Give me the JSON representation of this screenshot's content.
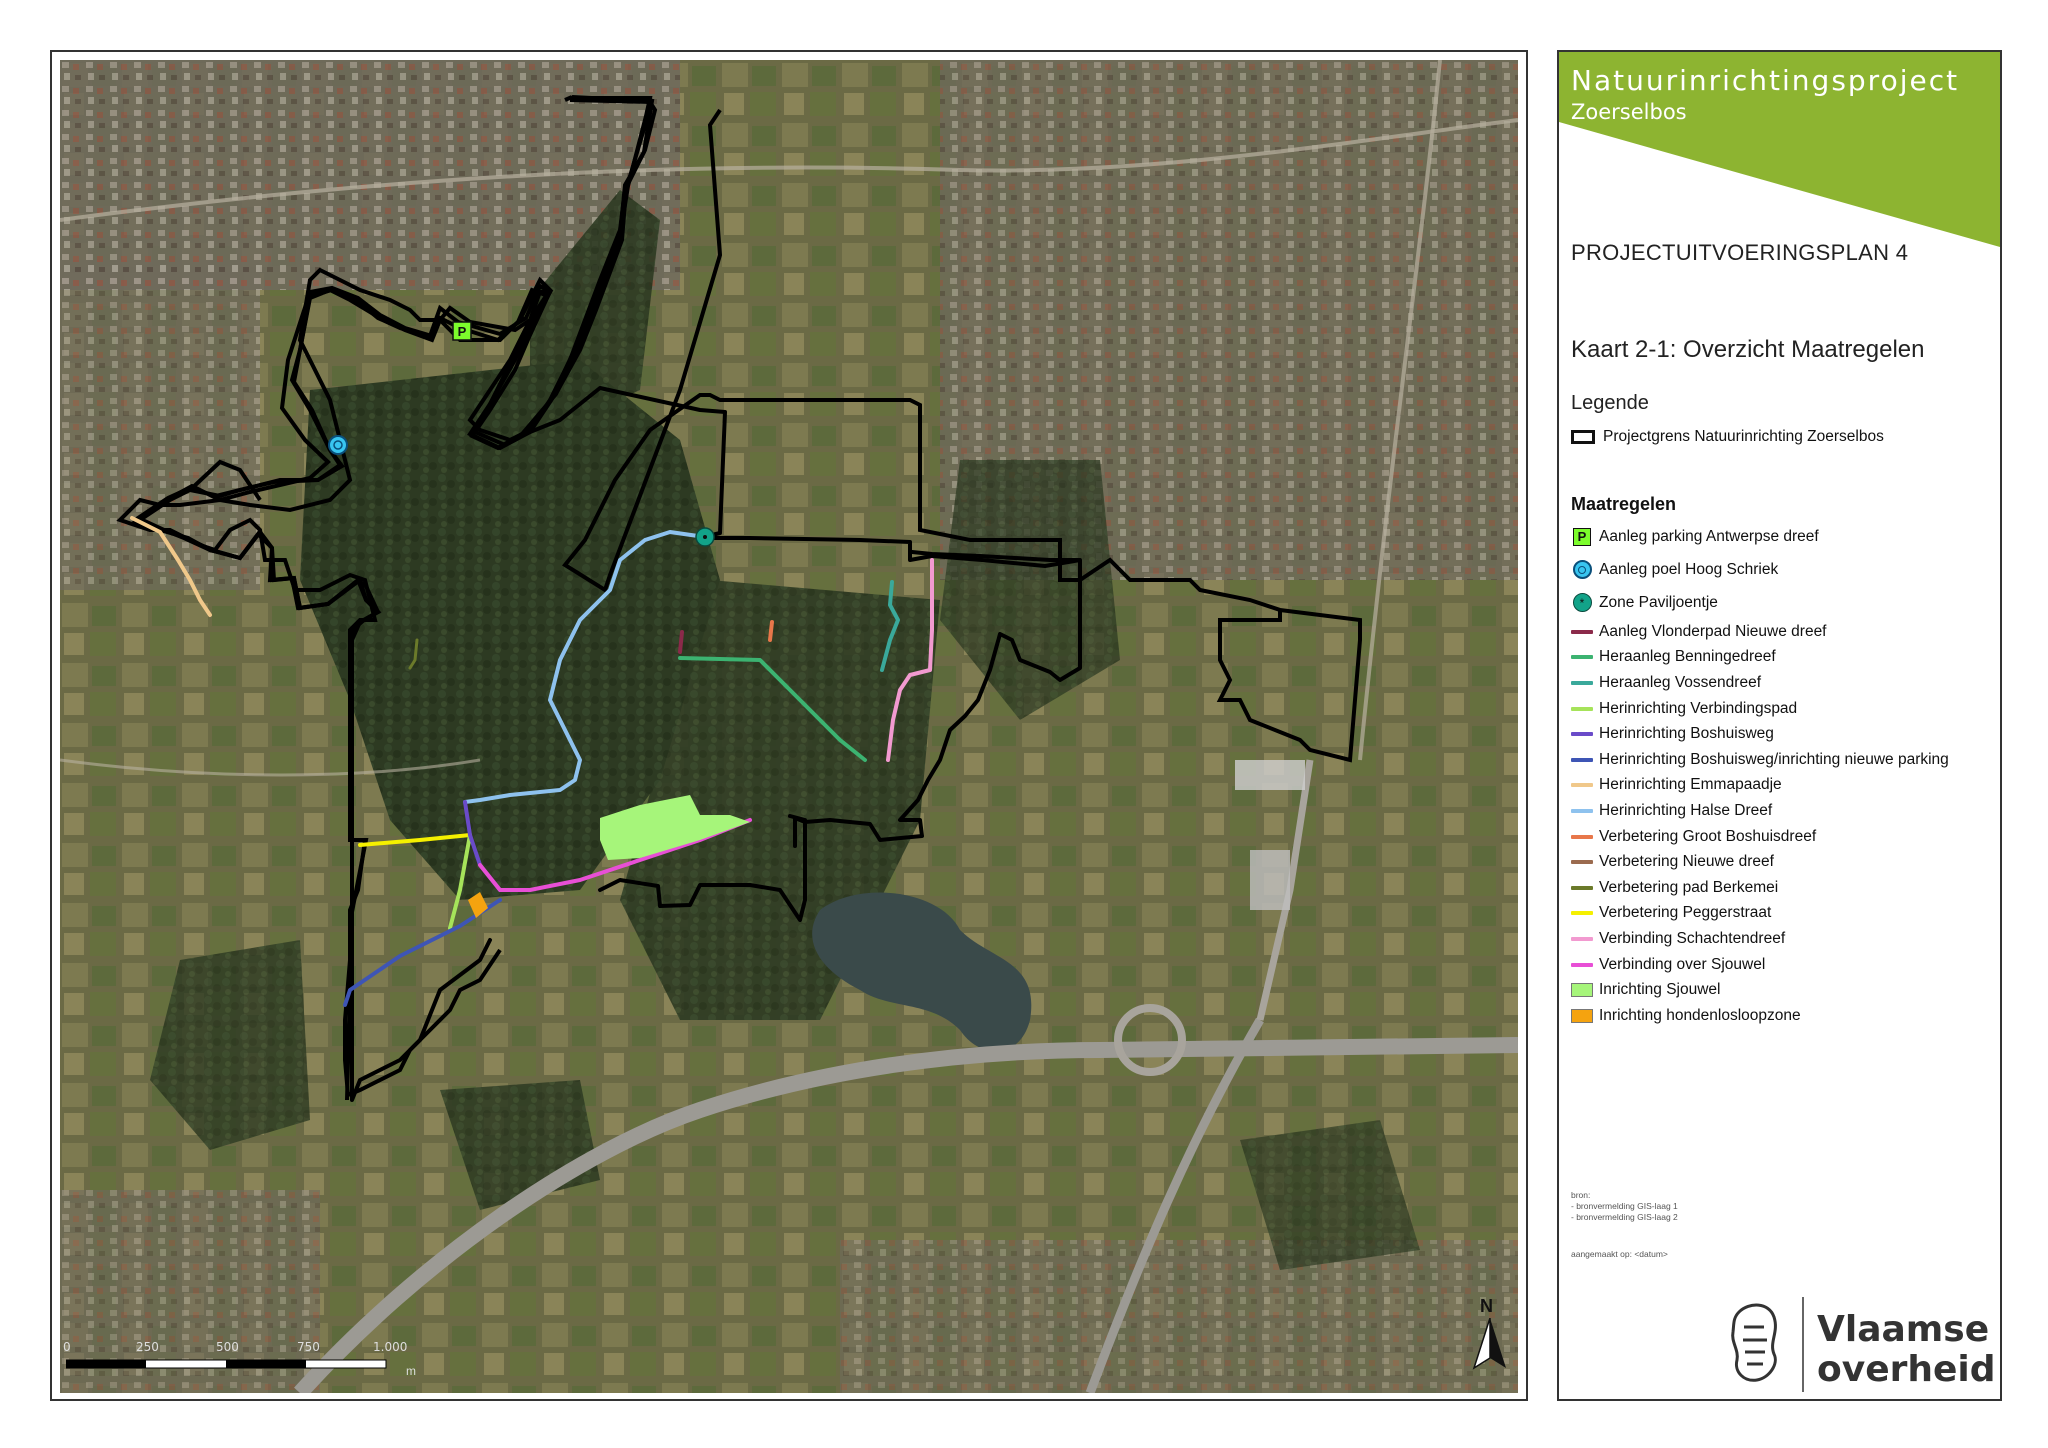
{
  "header": {
    "project_title": "Natuurinrichtingsproject",
    "project_subtitle": "Zoerselbos",
    "brand_color": "#8db431"
  },
  "plan_title": "PROJECTUITVOERINGSPLAN 4",
  "map_title": "Kaart 2-1: Overzicht Maatregelen",
  "legend": {
    "title": "Legende",
    "boundary_label": "Projectgrens Natuurinrichting Zoerselbos",
    "measures_title": "Maatregelen",
    "measures": [
      {
        "label": "Aanleg parking Antwerpse dreef",
        "symbol": "parking-icon",
        "symbol_text": "P",
        "color": "#7cfc2c"
      },
      {
        "label": "Aanleg poel Hoog Schriek",
        "symbol": "pool-icon",
        "color": "#38c5f0"
      },
      {
        "label": "Zone Paviljoentje",
        "symbol": "pavilion-icon",
        "symbol_text": "*",
        "color": "#12a389"
      },
      {
        "label": "Aanleg Vlonderpad Nieuwe dreef",
        "symbol": "line",
        "color": "#8b2a4a"
      },
      {
        "label": "Heraanleg Benningedreef",
        "symbol": "line",
        "color": "#3cb371"
      },
      {
        "label": "Heraanleg Vossendreef",
        "symbol": "line",
        "color": "#3aa99b"
      },
      {
        "label": "Herinrichting Verbindingspad",
        "symbol": "line",
        "color": "#a6e35a"
      },
      {
        "label": "Herinrichting Boshuisweg",
        "symbol": "line",
        "color": "#6a4bc9"
      },
      {
        "label": "Herinrichting Boshuisweg/inrichting nieuwe parking",
        "symbol": "line",
        "color": "#3e55b5"
      },
      {
        "label": "Herinrichting Emmapaadje",
        "symbol": "line",
        "color": "#f0c88a"
      },
      {
        "label": "Herinrichting Halse Dreef",
        "symbol": "line",
        "color": "#8ec2ee"
      },
      {
        "label": "Verbetering Groot Boshuisdreef",
        "symbol": "line",
        "color": "#e8774a"
      },
      {
        "label": "Verbetering Nieuwe dreef",
        "symbol": "line",
        "color": "#9b6b4f"
      },
      {
        "label": "Verbetering pad Berkemei",
        "symbol": "line",
        "color": "#6b7a2a"
      },
      {
        "label": "Verbetering Peggerstraat",
        "symbol": "line",
        "color": "#f5f000"
      },
      {
        "label": "Verbinding Schachtendreef",
        "symbol": "line",
        "color": "#f29ad0"
      },
      {
        "label": "Verbinding over Sjouwel",
        "symbol": "line",
        "color": "#e84fd6"
      },
      {
        "label": "Inrichting Sjouwel",
        "symbol": "area",
        "color": "#a6f57a"
      },
      {
        "label": "Inrichting hondenlosloopzone",
        "symbol": "area",
        "color": "#f5a30f"
      }
    ]
  },
  "sources": {
    "title": "bron:",
    "items": [
      "- bronvermelding GIS-laag 1",
      "- bronvermelding GIS-laag 2"
    ],
    "created": "aangemaakt op: <datum>"
  },
  "logo": {
    "line1": "Vlaamse",
    "line2": "overheid"
  },
  "scale": {
    "ticks": [
      "0",
      "250",
      "500",
      "750",
      "1.000"
    ],
    "unit": "m"
  },
  "north_label": "N",
  "map_markers": {
    "parking": "P"
  }
}
